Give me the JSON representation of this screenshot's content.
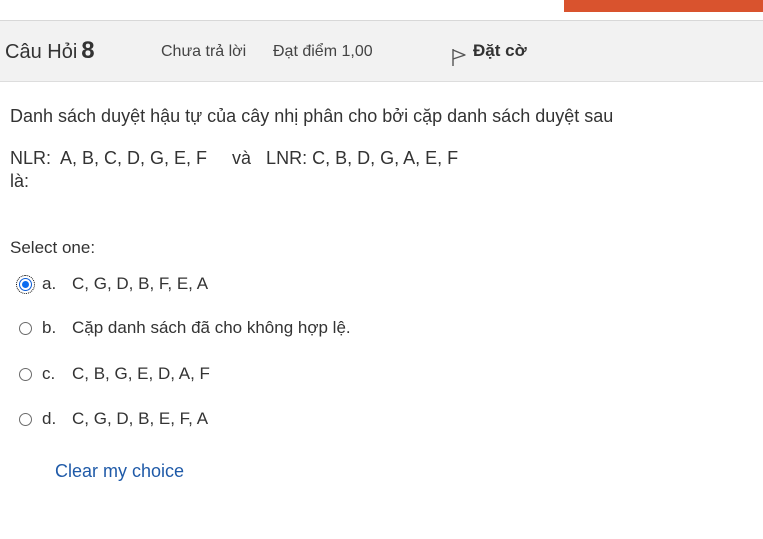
{
  "header": {
    "title_prefix": "Câu Hỏi",
    "number": "8",
    "state": "Chưa trả lời",
    "grade": "Đạt điểm 1,00",
    "flag_label": "Đặt cờ",
    "flag_icon": "flag-outline-icon"
  },
  "question": {
    "line1": "Danh sách duyệt hậu tự của cây nhị phân cho bởi cặp danh sách duyệt sau",
    "line2": "NLR:  A, B, C, D, G, E, F     và   LNR: C, B, D, G, A, E, F",
    "line3": "là:"
  },
  "prompt": "Select one:",
  "answers": [
    {
      "letter": "a.",
      "text": "C, G, D, B, F, E, A",
      "selected": true
    },
    {
      "letter": "b.",
      "text": "Cặp danh sách đã cho không hợp lệ.",
      "selected": false
    },
    {
      "letter": "c.",
      "text": "C, B, G, E, D, A, F",
      "selected": false
    },
    {
      "letter": "d.",
      "text": "C, G, D, B, E, F, A",
      "selected": false
    }
  ],
  "clear_choice": "Clear my choice",
  "colors": {
    "accent_button": "#d9532e",
    "link": "#1f5aa8",
    "radio_selected": "#0b6cf0",
    "info_bar_bg": "#f2f2f2"
  }
}
